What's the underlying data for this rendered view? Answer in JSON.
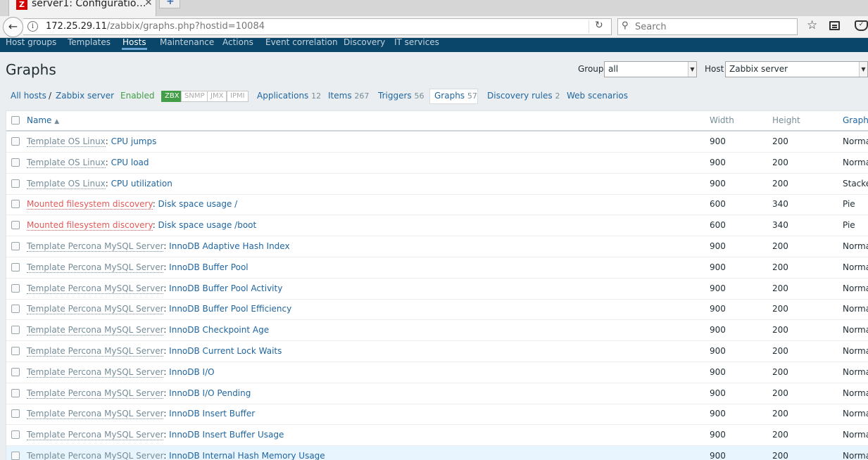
{
  "browser": {
    "tab_title": "server1: Configuratio…",
    "favicon_letter": "Z",
    "url_host": "172.25.29.11",
    "url_path": "/zabbix/graphs.php?hostid=10084",
    "search_placeholder": "Search"
  },
  "topmenu": [
    {
      "label": "Host groups",
      "active": false
    },
    {
      "label": "Templates",
      "active": false
    },
    {
      "label": "Hosts",
      "active": true
    },
    {
      "label": "Maintenance",
      "active": false
    },
    {
      "label": "Actions",
      "active": false
    },
    {
      "label": "Event correlation",
      "active": false
    },
    {
      "label": "Discovery",
      "active": false
    },
    {
      "label": "IT services",
      "active": false
    }
  ],
  "page": {
    "title": "Graphs",
    "group_label": "Group",
    "group_value": "all",
    "host_label": "Host",
    "host_value": "Zabbix server"
  },
  "hostnav": {
    "all_hosts": "All hosts",
    "separator": "/",
    "host": "Zabbix server",
    "status": "Enabled",
    "badges": [
      {
        "label": "ZBX",
        "on": true
      },
      {
        "label": "SNMP",
        "on": false
      },
      {
        "label": "JMX",
        "on": false
      },
      {
        "label": "IPMI",
        "on": false
      }
    ],
    "applications": {
      "label": "Applications",
      "count": "12"
    },
    "items": {
      "label": "Items",
      "count": "267"
    },
    "triggers": {
      "label": "Triggers",
      "count": "56"
    },
    "graphs": {
      "label": "Graphs",
      "count": "57"
    },
    "discovery": {
      "label": "Discovery rules",
      "count": "2"
    },
    "web": {
      "label": "Web scenarios"
    }
  },
  "table": {
    "columns": {
      "name": "Name",
      "sort_indicator": "▲",
      "width": "Width",
      "height": "Height",
      "graph_type": "Graph"
    },
    "rows": [
      {
        "template": "Template OS Linux",
        "kind": "template",
        "name": "CPU jumps",
        "width": "900",
        "height": "200",
        "type": "Norma"
      },
      {
        "template": "Template OS Linux",
        "kind": "template",
        "name": "CPU load",
        "width": "900",
        "height": "200",
        "type": "Norma"
      },
      {
        "template": "Template OS Linux",
        "kind": "template",
        "name": "CPU utilization",
        "width": "900",
        "height": "200",
        "type": "Stacke"
      },
      {
        "template": "Mounted filesystem discovery",
        "kind": "discovery",
        "name": "Disk space usage /",
        "width": "600",
        "height": "340",
        "type": "Pie"
      },
      {
        "template": "Mounted filesystem discovery",
        "kind": "discovery",
        "name": "Disk space usage /boot",
        "width": "600",
        "height": "340",
        "type": "Pie"
      },
      {
        "template": "Template Percona MySQL Server",
        "kind": "template",
        "name": "InnoDB Adaptive Hash Index",
        "width": "900",
        "height": "200",
        "type": "Norma"
      },
      {
        "template": "Template Percona MySQL Server",
        "kind": "template",
        "name": "InnoDB Buffer Pool",
        "width": "900",
        "height": "200",
        "type": "Norma"
      },
      {
        "template": "Template Percona MySQL Server",
        "kind": "template",
        "name": "InnoDB Buffer Pool Activity",
        "width": "900",
        "height": "200",
        "type": "Norma"
      },
      {
        "template": "Template Percona MySQL Server",
        "kind": "template",
        "name": "InnoDB Buffer Pool Efficiency",
        "width": "900",
        "height": "200",
        "type": "Norma"
      },
      {
        "template": "Template Percona MySQL Server",
        "kind": "template",
        "name": "InnoDB Checkpoint Age",
        "width": "900",
        "height": "200",
        "type": "Norma"
      },
      {
        "template": "Template Percona MySQL Server",
        "kind": "template",
        "name": "InnoDB Current Lock Waits",
        "width": "900",
        "height": "200",
        "type": "Norma"
      },
      {
        "template": "Template Percona MySQL Server",
        "kind": "template",
        "name": "InnoDB I/O",
        "width": "900",
        "height": "200",
        "type": "Norma"
      },
      {
        "template": "Template Percona MySQL Server",
        "kind": "template",
        "name": "InnoDB I/O Pending",
        "width": "900",
        "height": "200",
        "type": "Norma"
      },
      {
        "template": "Template Percona MySQL Server",
        "kind": "template",
        "name": "InnoDB Insert Buffer",
        "width": "900",
        "height": "200",
        "type": "Norma"
      },
      {
        "template": "Template Percona MySQL Server",
        "kind": "template",
        "name": "InnoDB Insert Buffer Usage",
        "width": "900",
        "height": "200",
        "type": "Norma"
      },
      {
        "template": "Template Percona MySQL Server",
        "kind": "template",
        "name": "InnoDB Internal Hash Memory Usage",
        "width": "900",
        "height": "200",
        "type": "Norma",
        "highlight": true
      }
    ]
  }
}
